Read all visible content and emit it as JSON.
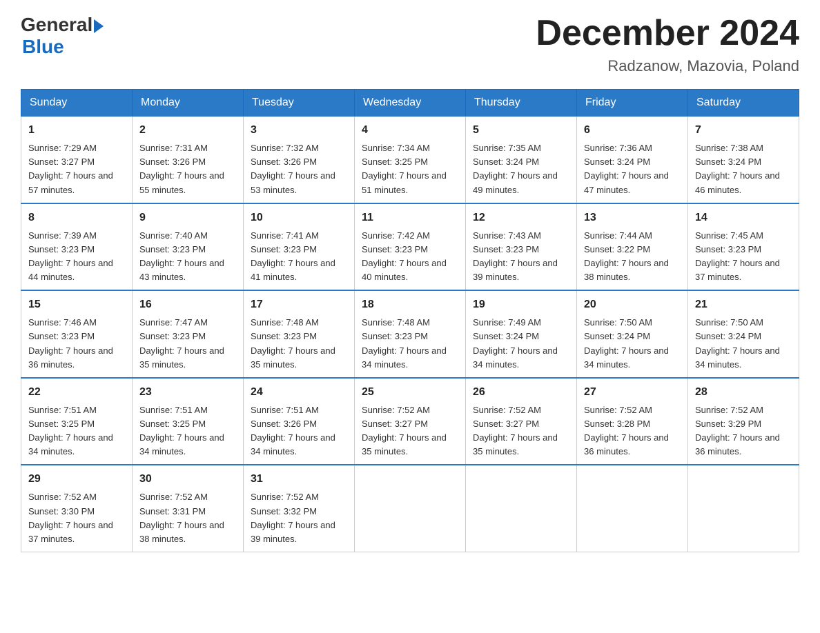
{
  "header": {
    "logo": {
      "general": "General",
      "blue": "Blue"
    },
    "title": "December 2024",
    "location": "Radzanow, Mazovia, Poland"
  },
  "calendar": {
    "days_of_week": [
      "Sunday",
      "Monday",
      "Tuesday",
      "Wednesday",
      "Thursday",
      "Friday",
      "Saturday"
    ],
    "weeks": [
      [
        {
          "day": "1",
          "sunrise": "7:29 AM",
          "sunset": "3:27 PM",
          "daylight": "7 hours and 57 minutes."
        },
        {
          "day": "2",
          "sunrise": "7:31 AM",
          "sunset": "3:26 PM",
          "daylight": "7 hours and 55 minutes."
        },
        {
          "day": "3",
          "sunrise": "7:32 AM",
          "sunset": "3:26 PM",
          "daylight": "7 hours and 53 minutes."
        },
        {
          "day": "4",
          "sunrise": "7:34 AM",
          "sunset": "3:25 PM",
          "daylight": "7 hours and 51 minutes."
        },
        {
          "day": "5",
          "sunrise": "7:35 AM",
          "sunset": "3:24 PM",
          "daylight": "7 hours and 49 minutes."
        },
        {
          "day": "6",
          "sunrise": "7:36 AM",
          "sunset": "3:24 PM",
          "daylight": "7 hours and 47 minutes."
        },
        {
          "day": "7",
          "sunrise": "7:38 AM",
          "sunset": "3:24 PM",
          "daylight": "7 hours and 46 minutes."
        }
      ],
      [
        {
          "day": "8",
          "sunrise": "7:39 AM",
          "sunset": "3:23 PM",
          "daylight": "7 hours and 44 minutes."
        },
        {
          "day": "9",
          "sunrise": "7:40 AM",
          "sunset": "3:23 PM",
          "daylight": "7 hours and 43 minutes."
        },
        {
          "day": "10",
          "sunrise": "7:41 AM",
          "sunset": "3:23 PM",
          "daylight": "7 hours and 41 minutes."
        },
        {
          "day": "11",
          "sunrise": "7:42 AM",
          "sunset": "3:23 PM",
          "daylight": "7 hours and 40 minutes."
        },
        {
          "day": "12",
          "sunrise": "7:43 AM",
          "sunset": "3:23 PM",
          "daylight": "7 hours and 39 minutes."
        },
        {
          "day": "13",
          "sunrise": "7:44 AM",
          "sunset": "3:22 PM",
          "daylight": "7 hours and 38 minutes."
        },
        {
          "day": "14",
          "sunrise": "7:45 AM",
          "sunset": "3:23 PM",
          "daylight": "7 hours and 37 minutes."
        }
      ],
      [
        {
          "day": "15",
          "sunrise": "7:46 AM",
          "sunset": "3:23 PM",
          "daylight": "7 hours and 36 minutes."
        },
        {
          "day": "16",
          "sunrise": "7:47 AM",
          "sunset": "3:23 PM",
          "daylight": "7 hours and 35 minutes."
        },
        {
          "day": "17",
          "sunrise": "7:48 AM",
          "sunset": "3:23 PM",
          "daylight": "7 hours and 35 minutes."
        },
        {
          "day": "18",
          "sunrise": "7:48 AM",
          "sunset": "3:23 PM",
          "daylight": "7 hours and 34 minutes."
        },
        {
          "day": "19",
          "sunrise": "7:49 AM",
          "sunset": "3:24 PM",
          "daylight": "7 hours and 34 minutes."
        },
        {
          "day": "20",
          "sunrise": "7:50 AM",
          "sunset": "3:24 PM",
          "daylight": "7 hours and 34 minutes."
        },
        {
          "day": "21",
          "sunrise": "7:50 AM",
          "sunset": "3:24 PM",
          "daylight": "7 hours and 34 minutes."
        }
      ],
      [
        {
          "day": "22",
          "sunrise": "7:51 AM",
          "sunset": "3:25 PM",
          "daylight": "7 hours and 34 minutes."
        },
        {
          "day": "23",
          "sunrise": "7:51 AM",
          "sunset": "3:25 PM",
          "daylight": "7 hours and 34 minutes."
        },
        {
          "day": "24",
          "sunrise": "7:51 AM",
          "sunset": "3:26 PM",
          "daylight": "7 hours and 34 minutes."
        },
        {
          "day": "25",
          "sunrise": "7:52 AM",
          "sunset": "3:27 PM",
          "daylight": "7 hours and 35 minutes."
        },
        {
          "day": "26",
          "sunrise": "7:52 AM",
          "sunset": "3:27 PM",
          "daylight": "7 hours and 35 minutes."
        },
        {
          "day": "27",
          "sunrise": "7:52 AM",
          "sunset": "3:28 PM",
          "daylight": "7 hours and 36 minutes."
        },
        {
          "day": "28",
          "sunrise": "7:52 AM",
          "sunset": "3:29 PM",
          "daylight": "7 hours and 36 minutes."
        }
      ],
      [
        {
          "day": "29",
          "sunrise": "7:52 AM",
          "sunset": "3:30 PM",
          "daylight": "7 hours and 37 minutes."
        },
        {
          "day": "30",
          "sunrise": "7:52 AM",
          "sunset": "3:31 PM",
          "daylight": "7 hours and 38 minutes."
        },
        {
          "day": "31",
          "sunrise": "7:52 AM",
          "sunset": "3:32 PM",
          "daylight": "7 hours and 39 minutes."
        },
        null,
        null,
        null,
        null
      ]
    ]
  }
}
